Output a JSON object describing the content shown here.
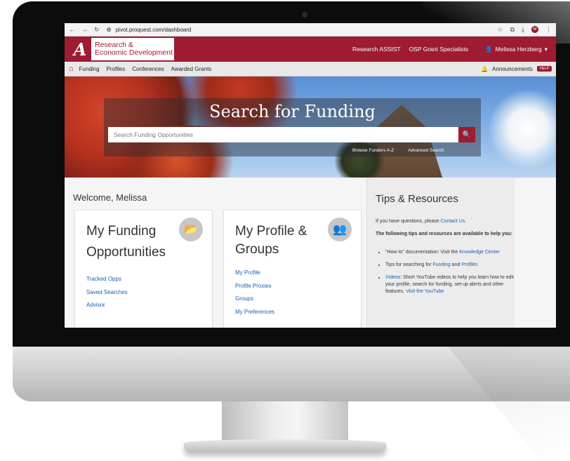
{
  "browser": {
    "url": "pivot.proquest.com/dashboard",
    "profile_initial": "M"
  },
  "header": {
    "logo_line1": "Research &",
    "logo_line2": "Economic Development",
    "logo_mark": "A",
    "links": [
      "Research ASSIST",
      "OSP Grant Specialists"
    ],
    "user_name": "Melissa Herzberg"
  },
  "subnav": {
    "items": [
      "Funding",
      "Profiles",
      "Conferences",
      "Awarded Grants"
    ],
    "announcements": "Announcements",
    "help": "HELP"
  },
  "hero": {
    "title": "Search for Funding",
    "search_placeholder": "Search Funding Opportunities",
    "browse_link": "Browse Funders A-Z",
    "advanced_link": "Advanced Search"
  },
  "main": {
    "welcome": "Welcome, Melissa",
    "funding_card": {
      "title_line1": "My Funding",
      "title_line2": "Opportunities",
      "links": [
        "Tracked Opps",
        "Saved Searches",
        "Advisor"
      ]
    },
    "profile_card": {
      "title_line1": "My Profile &",
      "title_line2": "Groups",
      "links": [
        "My Profile",
        "Profile Proxies",
        "Groups",
        "My Preferences"
      ]
    }
  },
  "tips": {
    "title": "Tips & Resources",
    "intro_prefix": "If you have questions, please ",
    "intro_link": "Contact Us.",
    "lead": "The following tips and resources are available to help you:",
    "items": [
      {
        "prefix": "\"How to\" documentation: Visit the ",
        "link": "Knowledge Center",
        "suffix": ""
      },
      {
        "prefix": "Tips for searching for ",
        "link": "Funding",
        "mid": " and ",
        "link2": "Profiles"
      },
      {
        "prefix_link": "Videos:",
        "text": " Short YouTube videos to help you learn how to edit your profile, search for funding, set-up alerts and other features. ",
        "link": "Visit the YouTube"
      }
    ]
  }
}
